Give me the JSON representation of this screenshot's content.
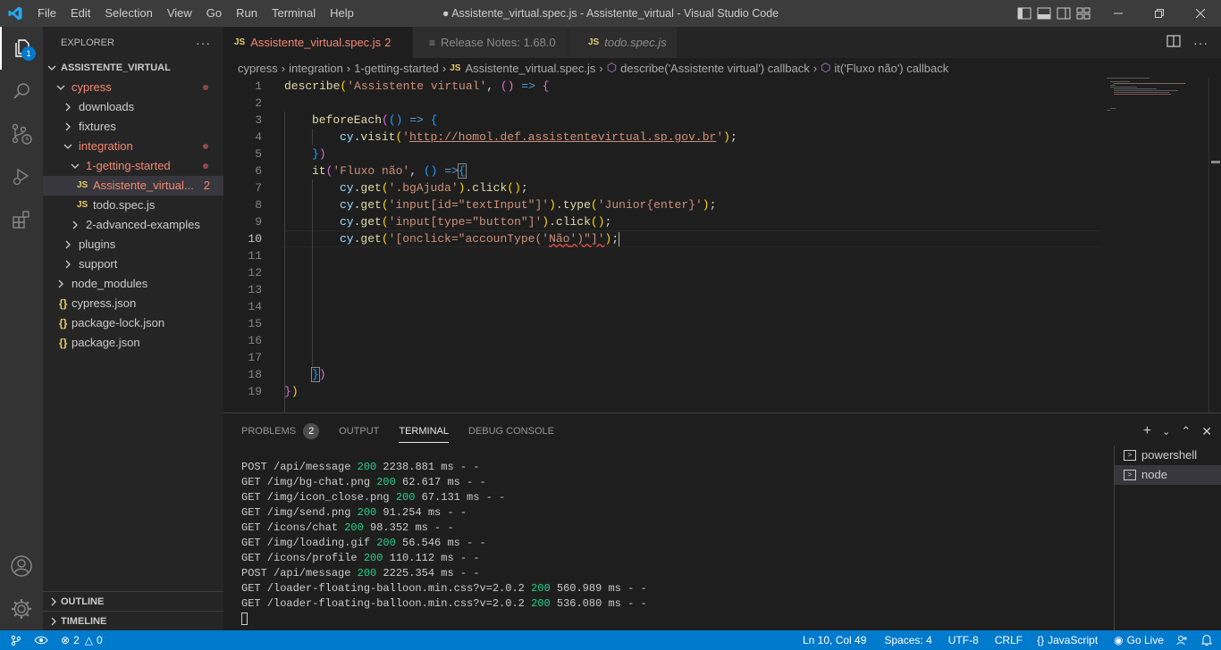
{
  "window": {
    "title": "● Assistente_virtual.spec.js - Assistente_virtual - Visual Studio Code",
    "menu": [
      "File",
      "Edit",
      "Selection",
      "View",
      "Go",
      "Run",
      "Terminal",
      "Help"
    ]
  },
  "activity": {
    "explorer_badge": "1"
  },
  "sidebar": {
    "header": "EXPLORER",
    "more": "···",
    "root": "ASSISTENTE_VIRTUAL",
    "tree": [
      {
        "label": "cypress",
        "depth": 1,
        "kind": "folder-open",
        "modified": true
      },
      {
        "label": "downloads",
        "depth": 2,
        "kind": "folder"
      },
      {
        "label": "fixtures",
        "depth": 2,
        "kind": "folder"
      },
      {
        "label": "integration",
        "depth": 2,
        "kind": "folder-open",
        "modified": true
      },
      {
        "label": "1-getting-started",
        "depth": 3,
        "kind": "folder-open",
        "modified": true
      },
      {
        "label": "Assistente_virtual...",
        "depth": 4,
        "kind": "js",
        "modified": true,
        "problems": "2",
        "selected": true
      },
      {
        "label": "todo.spec.js",
        "depth": 4,
        "kind": "js"
      },
      {
        "label": "2-advanced-examples",
        "depth": 3,
        "kind": "folder"
      },
      {
        "label": "plugins",
        "depth": 2,
        "kind": "folder"
      },
      {
        "label": "support",
        "depth": 2,
        "kind": "folder"
      },
      {
        "label": "node_modules",
        "depth": 1,
        "kind": "folder"
      },
      {
        "label": "cypress.json",
        "depth": 1,
        "kind": "json"
      },
      {
        "label": "package-lock.json",
        "depth": 1,
        "kind": "json"
      },
      {
        "label": "package.json",
        "depth": 1,
        "kind": "json"
      }
    ],
    "outline": "OUTLINE",
    "timeline": "TIMELINE"
  },
  "tabs": [
    {
      "label": "Assistente_virtual.spec.js",
      "badge": "2",
      "active": true
    },
    {
      "label": "Release Notes: 1.68.0"
    },
    {
      "label": "todo.spec.js"
    }
  ],
  "breadcrumb": [
    "cypress",
    "integration",
    "1-getting-started",
    "Assistente_virtual.spec.js",
    "describe('Assistente virtual') callback",
    "it('Fluxo não') callback"
  ],
  "editor": {
    "line_numbers": [
      "1",
      "2",
      "3",
      "4",
      "5",
      "6",
      "7",
      "8",
      "9",
      "10",
      "11",
      "12",
      "13",
      "14",
      "15",
      "16",
      "17",
      "18",
      "19"
    ],
    "current_line": "10",
    "code": {
      "l1": {
        "fn": "describe",
        "open": "(",
        "str": "'Assistente virtual'",
        "rest1": ", ",
        "paren": "()",
        "arrow": " => ",
        "brace": "{"
      },
      "l3": {
        "fn": "beforeEach",
        "open": "(",
        "paren": "()",
        "arrow": " => ",
        "brace": "{"
      },
      "l4": {
        "obj": "cy",
        "dot": ".",
        "fn": "visit",
        "open": "(",
        "q1": "'",
        "url": "http://homol.def.assistentevirtual.sp.gov.br",
        "q2": "'",
        "close": ")",
        "semi": ";"
      },
      "l5": {
        "brace": "}",
        "paren": ")"
      },
      "l6": {
        "fn": "it",
        "open": "(",
        "str": "'Fluxo não'",
        "rest": ", ",
        "paren": "()",
        "arrow": " =>",
        "brace": "{"
      },
      "l7": {
        "obj": "cy",
        "get": "get",
        "s1": "'.bgAjuda'",
        "click": "click",
        "tail": "();"
      },
      "l8": {
        "obj": "cy",
        "get": "get",
        "s1": "'input[id=\"textInput\"]'",
        "type": "type",
        "s2": "'Junior{enter}'",
        "tail": ");"
      },
      "l9": {
        "obj": "cy",
        "get": "get",
        "s1": "'input[type=\"button\"]'",
        "click": "click",
        "tail": "();"
      },
      "l10": {
        "obj": "cy",
        "get": "get",
        "s1": "'[onclick=\"accounType('",
        "s2": "Não",
        "s3": "')\"]'",
        "tail": ");"
      },
      "l18": {
        "brace": "}",
        "paren": ")"
      },
      "l19": {
        "brace": "}",
        "paren": ")"
      }
    }
  },
  "panel": {
    "tabs": [
      "PROBLEMS",
      "OUTPUT",
      "TERMINAL",
      "DEBUG CONSOLE"
    ],
    "problems_count": "2",
    "active_tab": "TERMINAL",
    "terminal_lines": [
      {
        "pre": "POST /api/message ",
        "code": "200",
        "post": " 2238.881 ms - -"
      },
      {
        "pre": "GET /img/bg-chat.png ",
        "code": "200",
        "post": " 62.617 ms - -"
      },
      {
        "pre": "GET /img/icon_close.png ",
        "code": "200",
        "post": " 67.131 ms - -"
      },
      {
        "pre": "GET /img/send.png ",
        "code": "200",
        "post": " 91.254 ms - -"
      },
      {
        "pre": "GET /icons/chat ",
        "code": "200",
        "post": " 98.352 ms - -"
      },
      {
        "pre": "GET /img/loading.gif ",
        "code": "200",
        "post": " 56.546 ms - -"
      },
      {
        "pre": "GET /icons/profile ",
        "code": "200",
        "post": " 110.112 ms - -"
      },
      {
        "pre": "POST /api/message ",
        "code": "200",
        "post": " 2225.354 ms - -"
      },
      {
        "pre": "GET /loader-floating-balloon.min.css?v=2.0.2 ",
        "code": "200",
        "post": " 560.989 ms - -"
      },
      {
        "pre": "GET /loader-floating-balloon.min.css?v=2.0.2 ",
        "code": "200",
        "post": " 536.080 ms - -"
      }
    ],
    "terminals": [
      "powershell",
      "node"
    ],
    "active_terminal": "node"
  },
  "status": {
    "errors": "2",
    "warnings": "0",
    "position": "Ln 10, Col 49",
    "spaces": "Spaces: 4",
    "encoding": "UTF-8",
    "eol": "CRLF",
    "language": "JavaScript",
    "golive": "Go Live"
  },
  "colors": {
    "accent": "#007acc",
    "modified": "#f48771",
    "success": "#23d18b"
  }
}
